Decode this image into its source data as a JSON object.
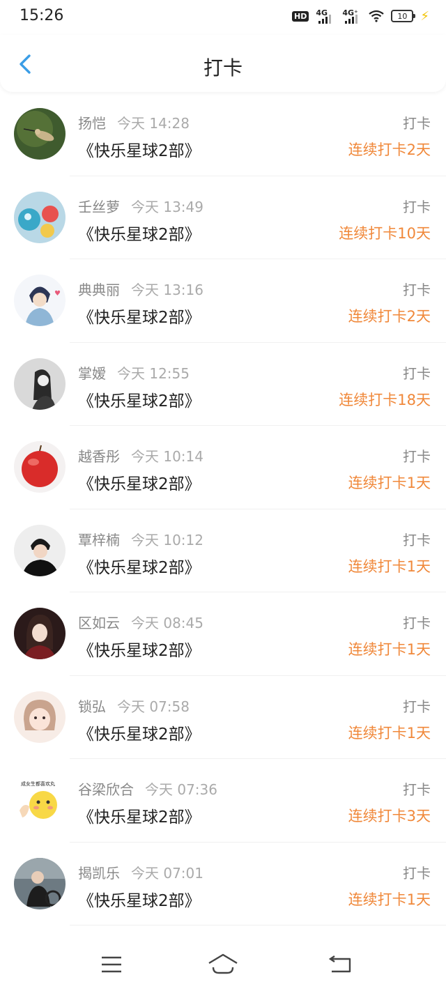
{
  "status": {
    "time": "15:26",
    "hd": "HD",
    "net1": "4G",
    "net2": "4G⁺",
    "battery": "10"
  },
  "header": {
    "title": "打卡",
    "back_icon": "chevron-left-icon"
  },
  "accent": "#f0883a",
  "items": [
    {
      "name": "扬恺",
      "time": "今天 14:28",
      "course": "《快乐星球2部》",
      "kind": "打卡",
      "streak": "连续打卡2天"
    },
    {
      "name": "壬丝萝",
      "time": "今天 13:49",
      "course": "《快乐星球2部》",
      "kind": "打卡",
      "streak": "连续打卡10天"
    },
    {
      "name": "典典丽",
      "time": "今天 13:16",
      "course": "《快乐星球2部》",
      "kind": "打卡",
      "streak": "连续打卡2天"
    },
    {
      "name": "掌嫒",
      "time": "今天 12:55",
      "course": "《快乐星球2部》",
      "kind": "打卡",
      "streak": "连续打卡18天"
    },
    {
      "name": "越香彤",
      "time": "今天 10:14",
      "course": "《快乐星球2部》",
      "kind": "打卡",
      "streak": "连续打卡1天"
    },
    {
      "name": "覃梓楠",
      "time": "今天 10:12",
      "course": "《快乐星球2部》",
      "kind": "打卡",
      "streak": "连续打卡1天"
    },
    {
      "name": "区如云",
      "time": "今天 08:45",
      "course": "《快乐星球2部》",
      "kind": "打卡",
      "streak": "连续打卡1天"
    },
    {
      "name": "锁弘",
      "time": "今天 07:58",
      "course": "《快乐星球2部》",
      "kind": "打卡",
      "streak": "连续打卡1天"
    },
    {
      "name": "谷梁欣合",
      "time": "今天 07:36",
      "course": "《快乐星球2部》",
      "kind": "打卡",
      "streak": "连续打卡3天"
    },
    {
      "name": "揭凯乐",
      "time": "今天 07:01",
      "course": "《快乐星球2部》",
      "kind": "打卡",
      "streak": "连续打卡1天"
    }
  ],
  "bottom_nav": [
    "menu-icon",
    "home-icon",
    "back-icon"
  ]
}
